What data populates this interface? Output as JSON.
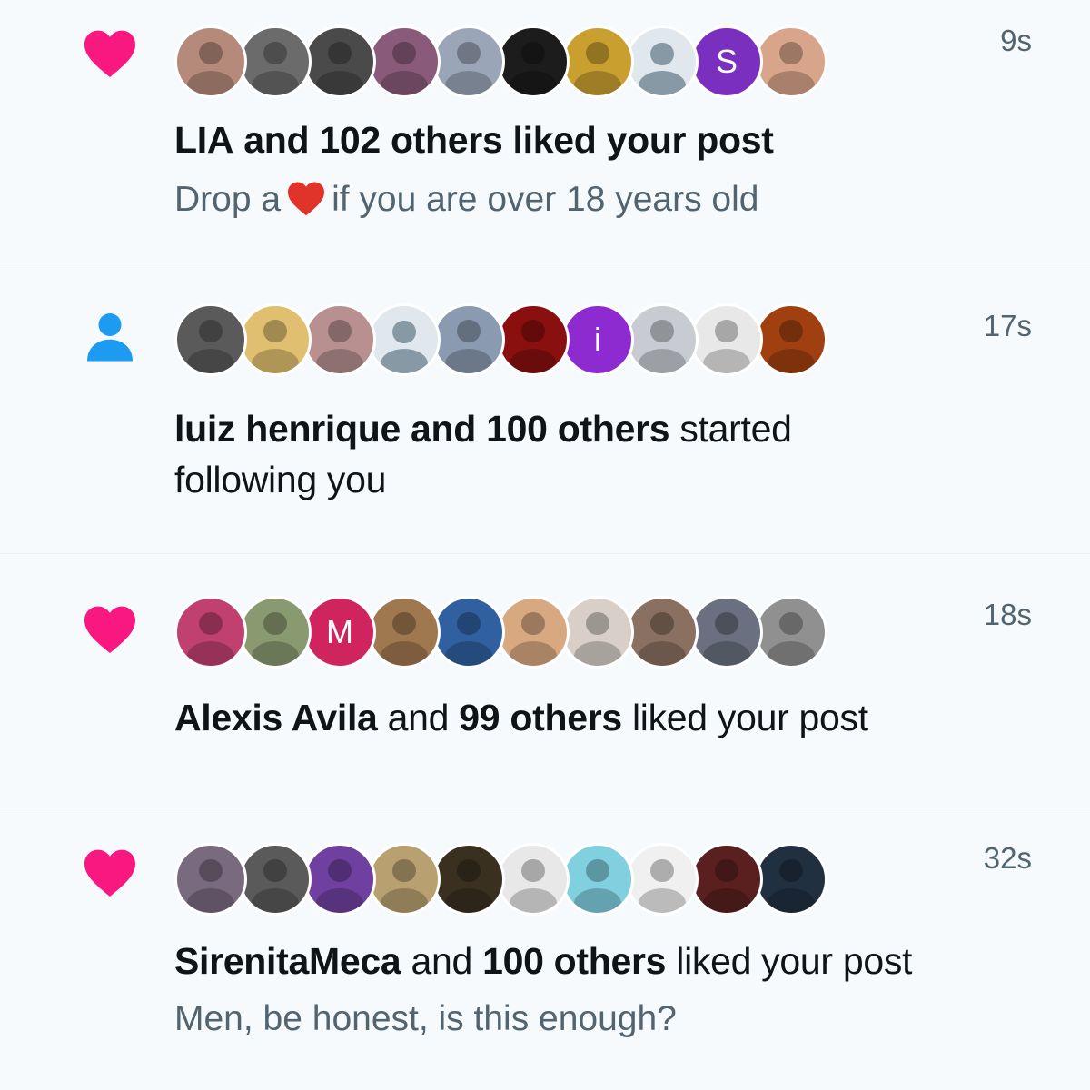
{
  "notifications": [
    {
      "type": "like",
      "icon": "heart-icon",
      "time": "9s",
      "actor": "LIA",
      "and": "and",
      "others": "102 others",
      "action": "liked your post",
      "post_pre": "Drop a",
      "post_emoji": "red-heart-emoji",
      "post_post": "if you are over 18 years old",
      "avatars": [
        {
          "color": "#b58a7a"
        },
        {
          "color": "#6b6b6b"
        },
        {
          "color": "#4a4a4a"
        },
        {
          "color": "#8a5a7a"
        },
        {
          "color": "#9aa6b8"
        },
        {
          "color": "#1c1c1c"
        },
        {
          "color": "#c9a030"
        },
        {
          "color": "#e1e8ed",
          "default": true
        },
        {
          "color": "#7b2fbe",
          "initial": "S"
        },
        {
          "color": "#d9a58a"
        }
      ]
    },
    {
      "type": "follow",
      "icon": "person-icon",
      "time": "17s",
      "actor": "luiz henrique",
      "and": "and",
      "others": "100 others",
      "action": "started following you",
      "avatars": [
        {
          "color": "#5a5a5a"
        },
        {
          "color": "#e0c070"
        },
        {
          "color": "#b89090"
        },
        {
          "color": "#e1e8ed",
          "default": true
        },
        {
          "color": "#8a9ab0"
        },
        {
          "color": "#8a1010"
        },
        {
          "color": "#8e2bd0",
          "initial": "i"
        },
        {
          "color": "#c8ccd2"
        },
        {
          "color": "#e8e8e8"
        },
        {
          "color": "#a04010"
        }
      ]
    },
    {
      "type": "like",
      "icon": "heart-icon",
      "time": "18s",
      "actor": "Alexis Avila",
      "and": "and",
      "others": "99 others",
      "action": "liked your post",
      "avatars": [
        {
          "color": "#c04070"
        },
        {
          "color": "#8a9a70"
        },
        {
          "color": "#d0245e",
          "initial": "M"
        },
        {
          "color": "#a07850"
        },
        {
          "color": "#3060a0"
        },
        {
          "color": "#d8a880"
        },
        {
          "color": "#d8d0c8"
        },
        {
          "color": "#8a7060"
        },
        {
          "color": "#6a7080"
        },
        {
          "color": "#909090"
        }
      ]
    },
    {
      "type": "like",
      "icon": "heart-icon",
      "time": "32s",
      "actor": "SirenitaMeca",
      "and": "and",
      "others": "100 others",
      "action": "liked your post",
      "post_text": "Men, be honest, is this enough?",
      "avatars": [
        {
          "color": "#7a6a80"
        },
        {
          "color": "#5a5a5a"
        },
        {
          "color": "#7040a0"
        },
        {
          "color": "#b8a070"
        },
        {
          "color": "#3a3020"
        },
        {
          "color": "#e8e8e8"
        },
        {
          "color": "#80d0e0"
        },
        {
          "color": "#f0f0f0"
        },
        {
          "color": "#5a2020"
        },
        {
          "color": "#203040"
        }
      ]
    }
  ],
  "colors": {
    "like_pink": "#f91880",
    "follow_blue": "#1d9bf0",
    "emoji_red": "#e0342a"
  }
}
